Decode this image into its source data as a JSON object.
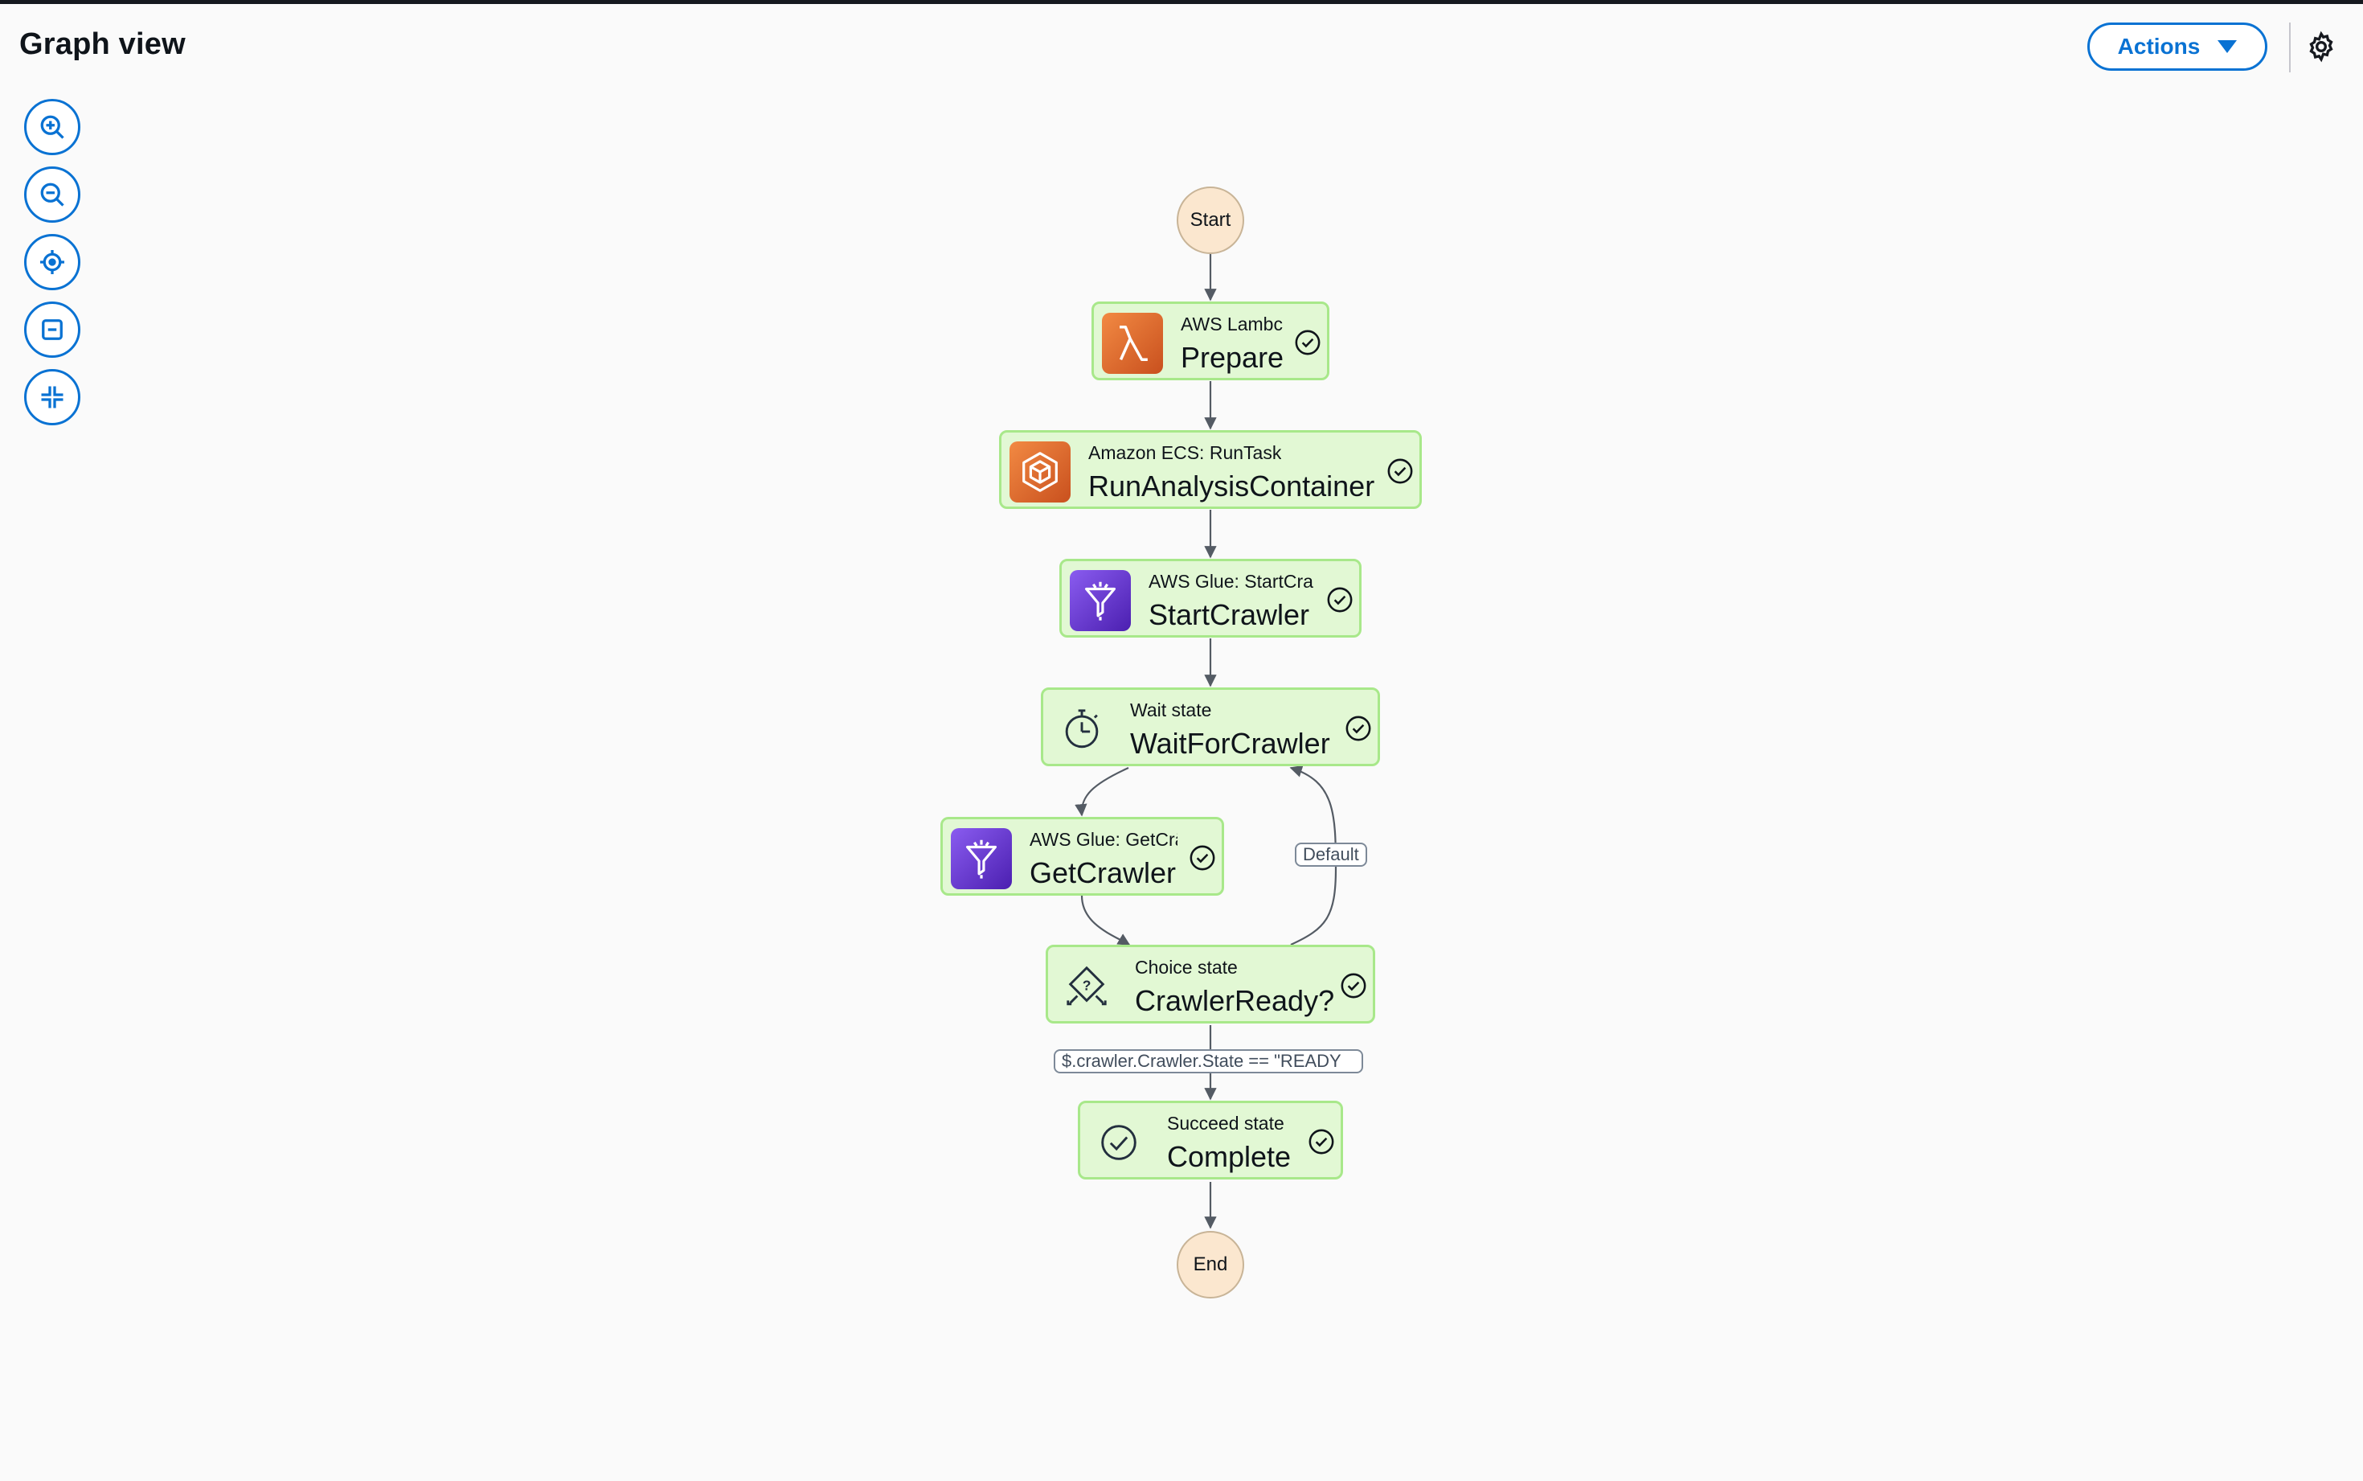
{
  "header": {
    "title": "Graph view",
    "actions_label": "Actions"
  },
  "icons": {
    "zoom_controls": [
      "zoom-in-icon",
      "zoom-out-icon",
      "center-icon",
      "fit-icon",
      "collapse-icon"
    ],
    "settings": "gear-icon"
  },
  "colors": {
    "accent": "#0972d3",
    "state_fill": "#e2f8d4",
    "state_border": "#a8e88a",
    "terminal_fill": "#fbe7cf",
    "edge": "#545b64"
  },
  "graph": {
    "start_label": "Start",
    "end_label": "End",
    "states": [
      {
        "id": "prepare",
        "type": "AWS Lambda: Invoke",
        "type_shown": "AWS Lambc",
        "name": "Prepare",
        "icon": "lambda-icon",
        "status": "succeeded"
      },
      {
        "id": "run",
        "type": "Amazon ECS: RunTask",
        "type_shown": "Amazon ECS: RunTask",
        "name": "RunAnalysisContainer",
        "icon": "ecs-icon",
        "status": "succeeded"
      },
      {
        "id": "start",
        "type": "AWS Glue: StartCrawler",
        "type_shown": "AWS Glue: StartCra",
        "name": "StartCrawler",
        "icon": "glue-icon",
        "status": "succeeded"
      },
      {
        "id": "wait",
        "type": "Wait state",
        "type_shown": "Wait state",
        "name": "WaitForCrawler",
        "icon": "timer-icon",
        "status": "succeeded"
      },
      {
        "id": "get",
        "type": "AWS Glue: GetCrawler",
        "type_shown": "AWS Glue: GetCrā",
        "name": "GetCrawler",
        "icon": "glue-icon",
        "status": "succeeded"
      },
      {
        "id": "choice",
        "type": "Choice state",
        "type_shown": "Choice state",
        "name": "CrawlerReady?",
        "icon": "choice-icon",
        "status": "succeeded"
      },
      {
        "id": "complete",
        "type": "Succeed state",
        "type_shown": "Succeed state",
        "name": "Complete",
        "icon": "check-circle-icon",
        "status": "succeeded"
      }
    ],
    "edge_labels": {
      "default": "Default",
      "condition": "$.crawler.Crawler.State == \"READY\"",
      "condition_shown": "$.crawler.Crawler.State == \"READY"
    }
  }
}
